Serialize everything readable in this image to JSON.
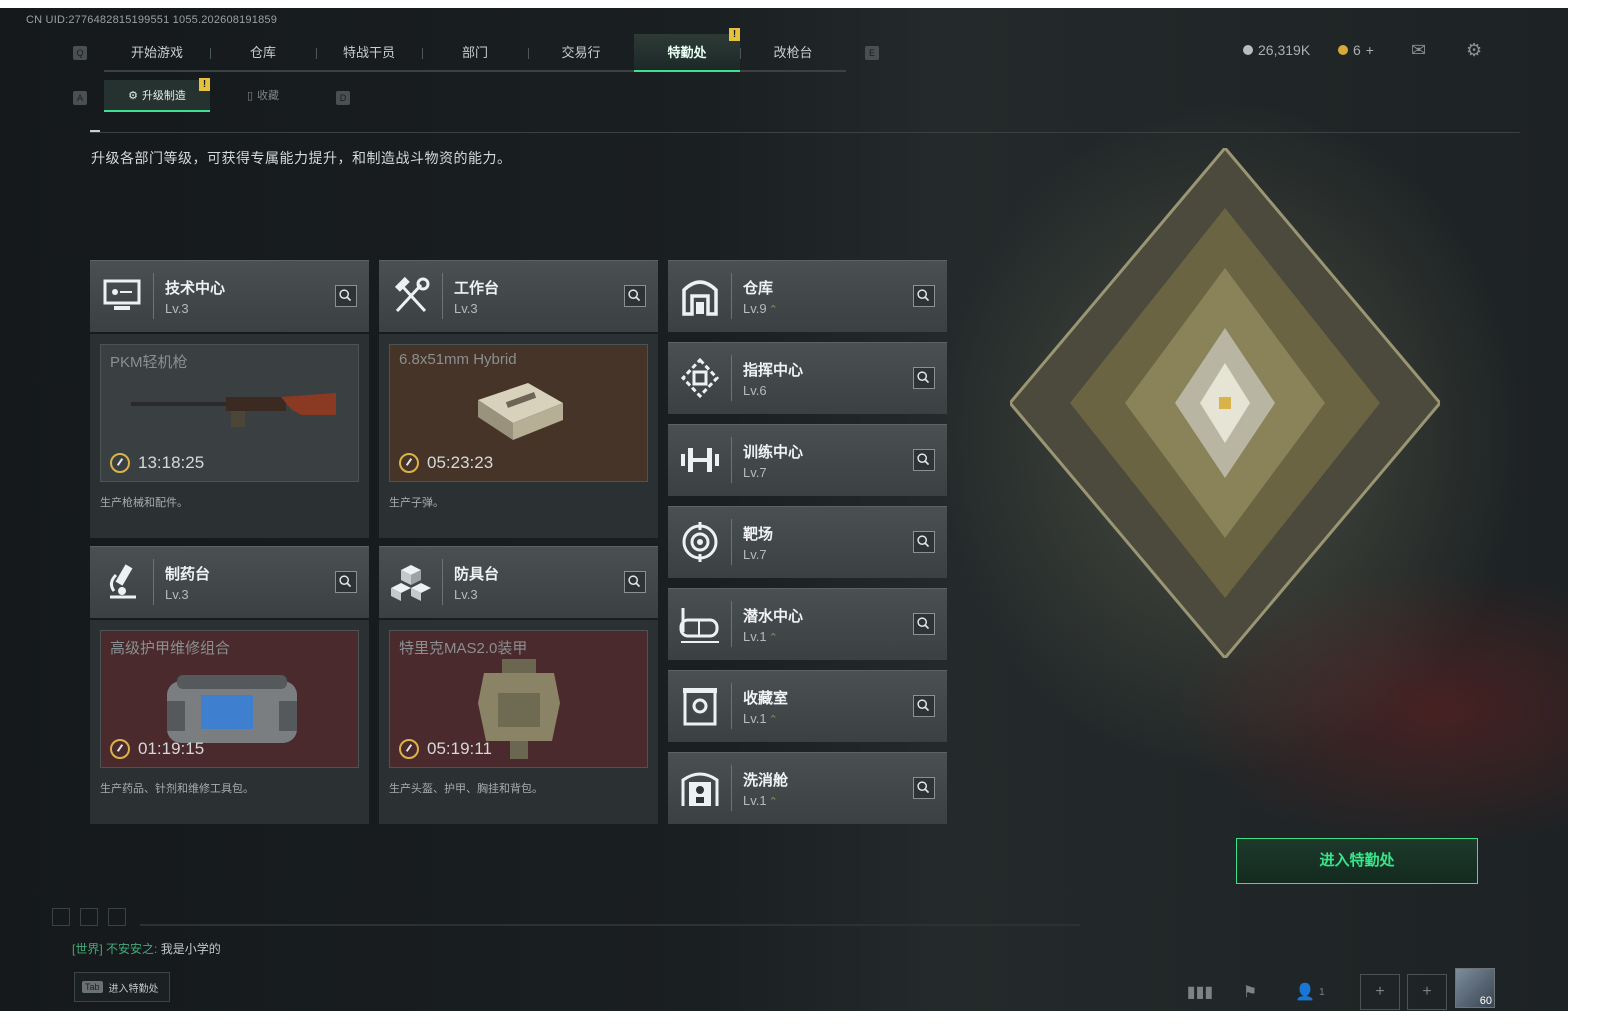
{
  "uid": "CN UID:2776482815199551 1055.202608191859",
  "keys": {
    "q": "Q",
    "e": "E",
    "a": "A",
    "d": "D"
  },
  "nav": {
    "tabs": [
      "开始游戏",
      "仓库",
      "特战干员",
      "部门",
      "交易行",
      "特勤处",
      "改枪台"
    ],
    "active": "特勤处",
    "badge": "!"
  },
  "subtabs": [
    {
      "label": "升级制造",
      "active": true,
      "badge": "!"
    },
    {
      "label": "收藏",
      "active": false
    }
  ],
  "description": "升级各部门等级，可获得专属能力提升，和制造战斗物资的能力。",
  "currency": {
    "silver": {
      "value": "26,319K",
      "color": "#b8bec0"
    },
    "gold": {
      "value": "6",
      "plus": "+",
      "color": "#d9a83a"
    }
  },
  "production_cards": [
    {
      "name": "技术中心",
      "level": "Lv.3",
      "product": "PKM轻机枪",
      "timer": "13:18:25",
      "note": "生产枪械和配件。",
      "icon": "monitor-icon",
      "tint": "gray"
    },
    {
      "name": "工作台",
      "level": "Lv.3",
      "product": "6.8x51mm Hybrid",
      "timer": "05:23:23",
      "note": "生产子弹。",
      "icon": "tools-icon",
      "tint": "brown"
    },
    {
      "name": "制药台",
      "level": "Lv.3",
      "product": "高级护甲维修组合",
      "timer": "01:19:15",
      "note": "生产药品、针剂和维修工具包。",
      "icon": "microscope-icon",
      "tint": "red"
    },
    {
      "name": "防具台",
      "level": "Lv.3",
      "product": "特里克MAS2.0装甲",
      "timer": "05:19:11",
      "note": "生产头盔、护甲、胸挂和背包。",
      "icon": "blocks-icon",
      "tint": "red"
    }
  ],
  "facilities": [
    {
      "name": "仓库",
      "level": "Lv.9",
      "upgradable": true,
      "icon": "warehouse-icon"
    },
    {
      "name": "指挥中心",
      "level": "Lv.6",
      "upgradable": false,
      "icon": "command-icon"
    },
    {
      "name": "训练中心",
      "level": "Lv.7",
      "upgradable": false,
      "icon": "dumbbell-icon"
    },
    {
      "name": "靶场",
      "level": "Lv.7",
      "upgradable": false,
      "icon": "target-icon"
    },
    {
      "name": "潜水中心",
      "level": "Lv.1",
      "upgradable": true,
      "icon": "diving-mask-icon"
    },
    {
      "name": "收藏室",
      "level": "Lv.1",
      "upgradable": true,
      "icon": "vault-icon"
    },
    {
      "name": "洗消舱",
      "level": "Lv.1",
      "upgradable": true,
      "icon": "decon-icon"
    }
  ],
  "enter_button": "进入特勤处",
  "chat": {
    "channel": "[世界]",
    "user": "不安安之:",
    "message": "我是小学的"
  },
  "tab_hint": {
    "key": "Tab",
    "label": "进入特勤处"
  },
  "friends_count": "1",
  "avatar_level": "60"
}
